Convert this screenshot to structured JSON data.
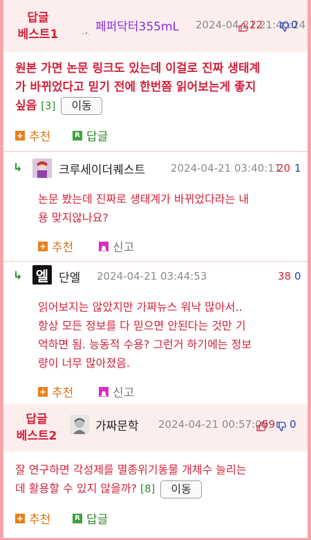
{
  "best1": {
    "badge": "답글\n베스트1",
    "nick": "페퍼닥터355mL",
    "date": "2024-04-21 21:40:24",
    "up": "22",
    "down": "0",
    "text_lines": [
      "원본 가면 논문 링크도 있는데 이걸로 진짜 생태계",
      "가 바뀌었다고 믿기 전에 한번쯤 읽어보는게 좋지",
      "싶음"
    ],
    "count": "[3]",
    "move_label": "이동",
    "recommend_label": "추천",
    "reply_label": "답글"
  },
  "reply1": {
    "nick": "크루세이더퀘스트",
    "date": "2024-04-21 03:40:11",
    "up": "20",
    "down": "1",
    "text_lines": [
      "논문 봤는데 진짜로 생태계가 바뀌었다라는 내",
      "용 맞지않나요?"
    ],
    "recommend_label": "추천",
    "report_label": "신고"
  },
  "reply2": {
    "nick": "단엘",
    "avatar_text": "엘",
    "date": "2024-04-21 03:44:53",
    "up": "38",
    "down": "0",
    "text_lines": [
      "읽어보지는 않았지만 가짜뉴스 워낙 많아서..",
      "항상 모든 정보를 다 믿으면 안된다는 것만 기",
      "억하면 됨. 능동적 수용? 그런거 하기에는 정보",
      "량이 너무 많아졌음."
    ],
    "recommend_label": "추천",
    "report_label": "신고"
  },
  "best2": {
    "badge": "답글\n베스트2",
    "nick": "가짜문학",
    "date": "2024-04-21 00:57:09",
    "up": "59",
    "down": "0",
    "text_lines": [
      "잘 연구하면 각성제를 멸종위기동물 개체수 늘리는",
      "데 활용할 수 있지 않을까?"
    ],
    "count": "[8]",
    "move_label": "이동",
    "recommend_label": "추천",
    "reply_label": "답글"
  },
  "colors": {
    "accent_red": "#d4213a",
    "page_bg": "#f4a7ab",
    "best_bg": "#fdeeee",
    "down_blue": "#1a3fbf",
    "green": "#2c8a2c",
    "orange": "#d9730d"
  }
}
